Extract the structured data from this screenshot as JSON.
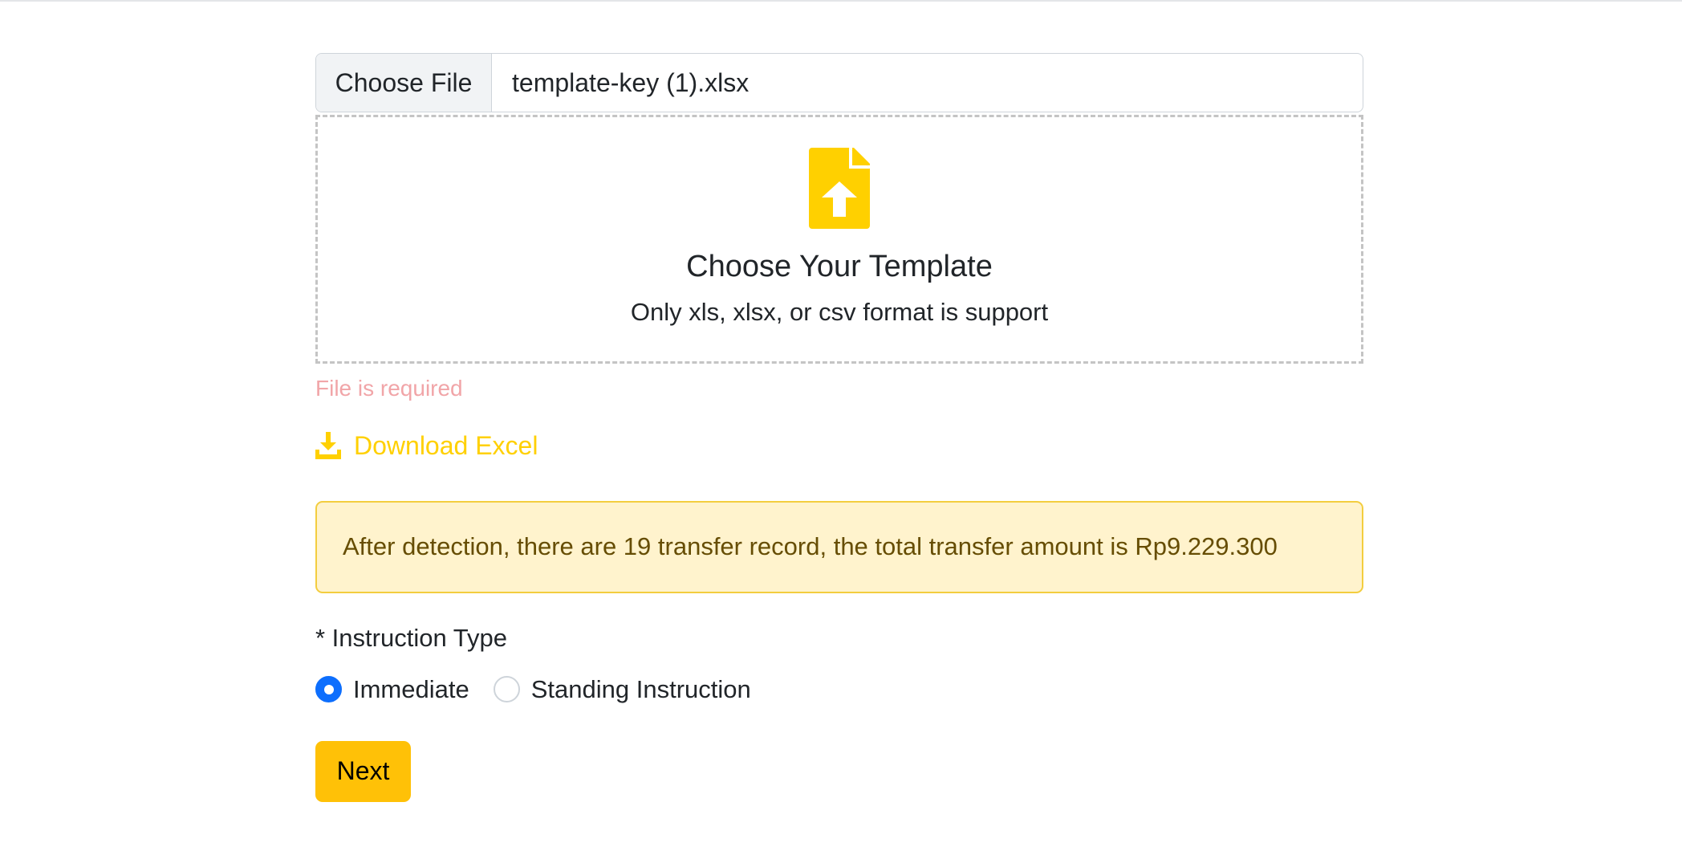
{
  "file_input": {
    "button_label": "Choose File",
    "file_name": "template-key (1).xlsx"
  },
  "dropzone": {
    "icon": "file-upload-icon",
    "title": "Choose Your Template",
    "subtitle": "Only xls, xlsx, or csv format is support"
  },
  "validation": {
    "error": "File is required"
  },
  "download": {
    "icon": "download-icon",
    "label": "Download Excel"
  },
  "alert": {
    "message": "After detection, there are 19 transfer record, the total transfer amount is Rp9.229.300"
  },
  "instruction_type": {
    "label": "* Instruction Type",
    "options": [
      {
        "label": "Immediate",
        "checked": true
      },
      {
        "label": "Standing Instruction",
        "checked": false
      }
    ]
  },
  "actions": {
    "next_label": "Next"
  },
  "colors": {
    "accent_yellow": "#ffd000",
    "button_yellow": "#ffc107",
    "radio_blue": "#0d6efd",
    "error_text": "#f1a5a8",
    "alert_bg": "#fff3cd",
    "alert_border": "#f3cd3f"
  }
}
